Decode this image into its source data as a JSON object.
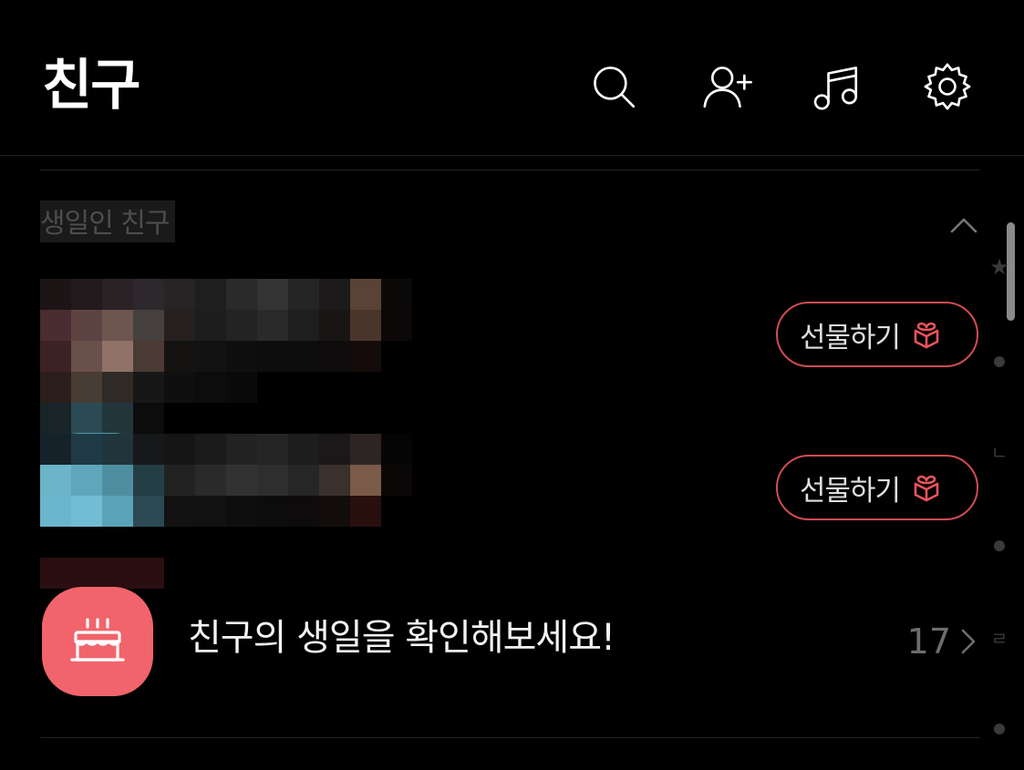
{
  "header": {
    "title": "친구",
    "icons": [
      "search-icon",
      "add-friend-icon",
      "music-icon",
      "settings-icon"
    ]
  },
  "birthday_section": {
    "label": "생일인 친구",
    "friends": [
      {
        "name": "",
        "gift_label": "선물하기",
        "gift_icon": "gift-icon"
      },
      {
        "name": "",
        "gift_label": "선물하기",
        "gift_icon": "gift-icon"
      }
    ],
    "check_birthdays": {
      "text": "친구의 생일을 확인해보세요!",
      "count": "17",
      "icon": "cake-icon"
    }
  },
  "index_bar": {
    "items": [
      "★",
      "•",
      "ㄴ",
      "•",
      "ㄹ",
      "•"
    ]
  },
  "colors": {
    "background": "#000000",
    "gift_accent": "#d04c54",
    "cake_badge": "#f2646c",
    "muted_text": "#6d6d6d"
  }
}
